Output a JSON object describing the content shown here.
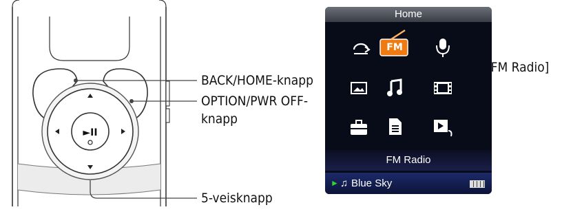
{
  "labels": {
    "back_home": "BACK/HOME-knapp",
    "option_line1": "OPTION/PWR OFF-",
    "option_line2": "knapp",
    "five_way": "5-veisknapp",
    "fm_radio": "[FM Radio]"
  },
  "screen": {
    "title": "Home",
    "fm_icon_text": "FM",
    "selected_label": "FM Radio",
    "now_playing": "Blue Sky",
    "icons": [
      "shuffle-icon",
      "fm-radio-icon",
      "microphone-icon",
      "photo-icon",
      "music-note-icon",
      "video-icon",
      "toolbox-icon",
      "document-icon",
      "playlist-icon"
    ]
  },
  "player": {
    "play_pause_glyph": "►II"
  },
  "colors": {
    "fm_orange": "#f07a12",
    "screen_bg": "#080b18",
    "callout_line": "#444444"
  }
}
